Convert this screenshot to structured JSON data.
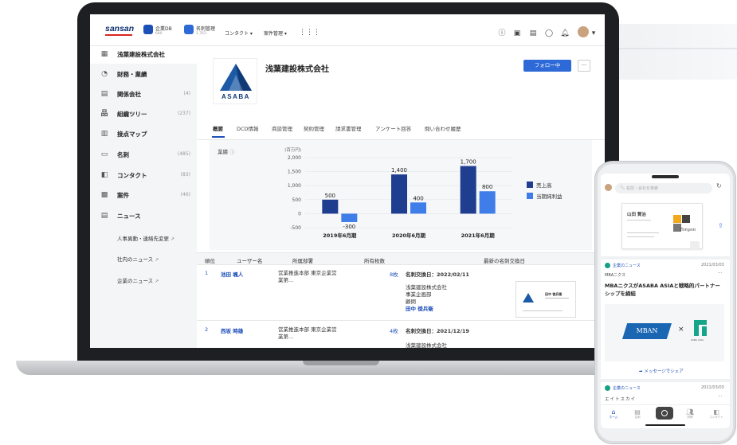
{
  "topbar": {
    "logo": "sansan",
    "nav": [
      {
        "label": "企業DB",
        "sub": "680"
      },
      {
        "label": "名刺管理",
        "sub": "1,763"
      },
      {
        "label": "コンタクト ▾"
      },
      {
        "label": "案件管理 ▾"
      }
    ]
  },
  "sidebar": {
    "company": "浅葉建設株式会社",
    "items": [
      {
        "label": "財務・業績",
        "count": ""
      },
      {
        "label": "関係会社",
        "count": "(4)"
      },
      {
        "label": "組織ツリー",
        "count": "(237)"
      },
      {
        "label": "接点マップ",
        "count": ""
      },
      {
        "label": "名刺",
        "count": "(485)"
      },
      {
        "label": "コンタクト",
        "count": "(83)"
      },
      {
        "label": "案件",
        "count": "(46)"
      },
      {
        "label": "ニュース",
        "count": ""
      }
    ],
    "sub_items": [
      "人事異動・連絡先変更",
      "社内のニュース",
      "企業のニュース"
    ]
  },
  "company": {
    "name": "浅葉建設株式会社",
    "logo_text": "ASABA",
    "follow_label": "フォロー中",
    "more_label": "···"
  },
  "tabs": [
    "概要",
    "DCD情報",
    "商談管理",
    "契約管理",
    "請求書管理",
    "アンケート回答",
    "問い合わせ履歴"
  ],
  "performance": {
    "label": "業績",
    "unit": "(百万円)"
  },
  "chart_data": {
    "type": "bar",
    "title": "",
    "ylabel": "(百万円)",
    "categories": [
      "2019年6月期",
      "2020年6月期",
      "2021年6月期"
    ],
    "series": [
      {
        "name": "売上高",
        "values": [
          500,
          1400,
          1700
        ],
        "color": "#1f3e8f"
      },
      {
        "name": "当期純利益",
        "values": [
          -300,
          400,
          800
        ],
        "color": "#3f7ee8"
      }
    ],
    "yticks": [
      "2,000",
      "1,500",
      "1,000",
      "500",
      "0",
      "-500"
    ],
    "ylim": [
      -500,
      2000
    ],
    "data_labels": [
      [
        "500",
        "1,400",
        "1,700"
      ],
      [
        "-300",
        "400",
        "800"
      ]
    ]
  },
  "table": {
    "headers": [
      "順位",
      "ユーザー名",
      "所属部署",
      "所有枚数",
      "最新の名刺交換日"
    ],
    "rows": [
      {
        "rank": "1",
        "user": "池田 颯人",
        "dept": "営業推進本部 東京企業営業第...",
        "count": "8枚",
        "date": "名刺交換日：2022/02/11",
        "card_company": "浅葉建設株式会社",
        "card_dept": "事業企画部",
        "card_title": "顧問",
        "card_name": "田中 徳兵衛",
        "mini_card_name": "田中 徳兵衛"
      },
      {
        "rank": "2",
        "user": "西坂 時雄",
        "dept": "営業推進本部 東京企業営業第...",
        "count": "4枚",
        "date": "名刺交換日：2021/12/19",
        "card_company": "浅葉建設株式会社"
      }
    ]
  },
  "phone": {
    "search_placeholder": "名前・会社を検索",
    "card_person": "山田 賢治",
    "card_brand": "Tonyon",
    "news1": {
      "source": "企業のニュース",
      "date": "2021/03/03",
      "company": "MBAニクス",
      "headline": "MBAニクスがASABA ASIAと戦略的パートナーシップを締結",
      "logo_left": "MBAN",
      "logo_x": "×",
      "logo_right_caption": "ASBA ASIA",
      "share": "メッセージでシェア"
    },
    "news2": {
      "source": "企業のニュース",
      "date": "2021/03/03",
      "company": "エイトスカイ"
    },
    "tabbar": [
      "ホーム",
      "名刺",
      "",
      "同僚",
      "コンタクト"
    ]
  }
}
